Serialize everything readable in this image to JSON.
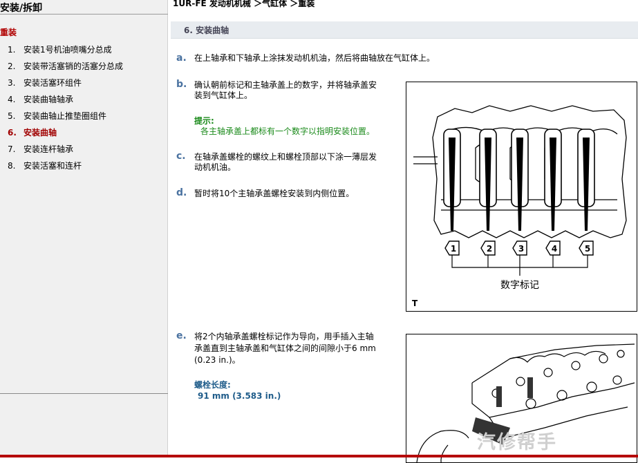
{
  "sidebar": {
    "title": "安装/拆卸",
    "section": "重装",
    "items": [
      {
        "num": "1.",
        "label": "安装1号机油喷嘴分总成"
      },
      {
        "num": "2.",
        "label": "安装带活塞销的活塞分总成"
      },
      {
        "num": "3.",
        "label": "安装活塞环组件"
      },
      {
        "num": "4.",
        "label": "安装曲轴轴承"
      },
      {
        "num": "5.",
        "label": "安装曲轴止推垫圈组件"
      },
      {
        "num": "6.",
        "label": "安装曲轴",
        "active": true
      },
      {
        "num": "7.",
        "label": "安装连杆轴承"
      },
      {
        "num": "8.",
        "label": "安装活塞和连杆"
      }
    ]
  },
  "breadcrumb": "1UR-FE 发动机机械 ＞气缸体 ＞重装",
  "step": {
    "title": "6. 安装曲轴"
  },
  "paragraphs": {
    "a": {
      "letter": "a.",
      "text": "在上轴承和下轴承上涂抹发动机机油，然后将曲轴放在气缸体上。"
    },
    "b": {
      "letter": "b.",
      "line1": "确认朝前标记和主轴承盖上的数字，并将轴承盖安",
      "line2": "装到气缸体上。"
    },
    "hint": {
      "title": "提示:",
      "text": "各主轴承盖上都标有一个数字以指明安装位置。"
    },
    "c": {
      "letter": "c.",
      "line1": "在轴承盖螺栓的螺纹上和螺栓顶部以下涂一薄层发",
      "line2": "动机机油。"
    },
    "d": {
      "letter": "d.",
      "text": "暂时将10个主轴承盖螺栓安装到内侧位置。"
    },
    "e": {
      "letter": "e.",
      "line1": "将2个内轴承盖螺栓标记作为导向，用手插入主轴",
      "line2": "承盖直到主轴承盖和气缸体之间的间隙小于6 mm",
      "line3": "(0.23 in.)。"
    },
    "spec": {
      "title": "螺栓长度:",
      "value": "91 mm (3.583 in.)"
    }
  },
  "figure1": {
    "numbers": [
      "1",
      "2",
      "3",
      "4",
      "5"
    ],
    "caption": "数字标记",
    "corner": "T"
  },
  "watermark": "汽修帮手"
}
